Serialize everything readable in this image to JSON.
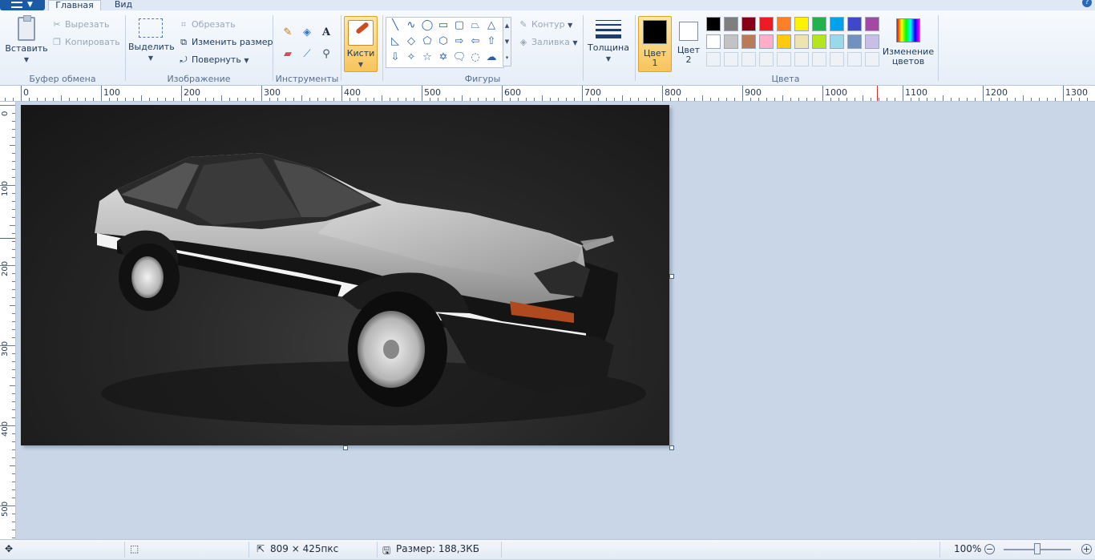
{
  "tabs": {
    "home": "Главная",
    "view": "Вид"
  },
  "clipboard": {
    "paste": "Вставить",
    "cut": "Вырезать",
    "copy": "Копировать",
    "group": "Буфер обмена"
  },
  "image": {
    "select": "Выделить",
    "crop": "Обрезать",
    "resize": "Изменить размер",
    "rotate": "Повернуть",
    "group": "Изображение"
  },
  "tools": {
    "group": "Инструменты",
    "text_tool": "A"
  },
  "brushes": {
    "label": "Кисти"
  },
  "shapes": {
    "outline": "Контур",
    "fill": "Заливка",
    "group": "Фигуры"
  },
  "thickness": {
    "label": "Толщина"
  },
  "colors": {
    "color1_line1": "Цвет",
    "color1_line2": "1",
    "color2_line1": "Цвет",
    "color2_line2": "2",
    "edit_line1": "Изменение",
    "edit_line2": "цветов",
    "group": "Цвета",
    "color1_value": "#000000",
    "color2_value": "#ffffff",
    "palette": [
      "#000000",
      "#7f7f7f",
      "#880015",
      "#ed1c24",
      "#ff7f27",
      "#fff200",
      "#22b14c",
      "#00a2e8",
      "#3f48cc",
      "#a349a4",
      "#ffffff",
      "#c3c3c3",
      "#b97a57",
      "#ffaec9",
      "#ffc90e",
      "#efe4b0",
      "#b5e61d",
      "#99d9ea",
      "#7092be",
      "#c8bfe7"
    ]
  },
  "ruler": {
    "horizontal": [
      "0",
      "100",
      "200",
      "300",
      "400",
      "500",
      "600",
      "700",
      "800",
      "900",
      "1000",
      "1100",
      "1200",
      "1300"
    ],
    "vertical": [
      "0",
      "100",
      "200",
      "300",
      "400",
      "500"
    ]
  },
  "status": {
    "dimensions": "809 × 425пкс",
    "size": "Размер: 188,3КБ",
    "zoom": "100%"
  }
}
